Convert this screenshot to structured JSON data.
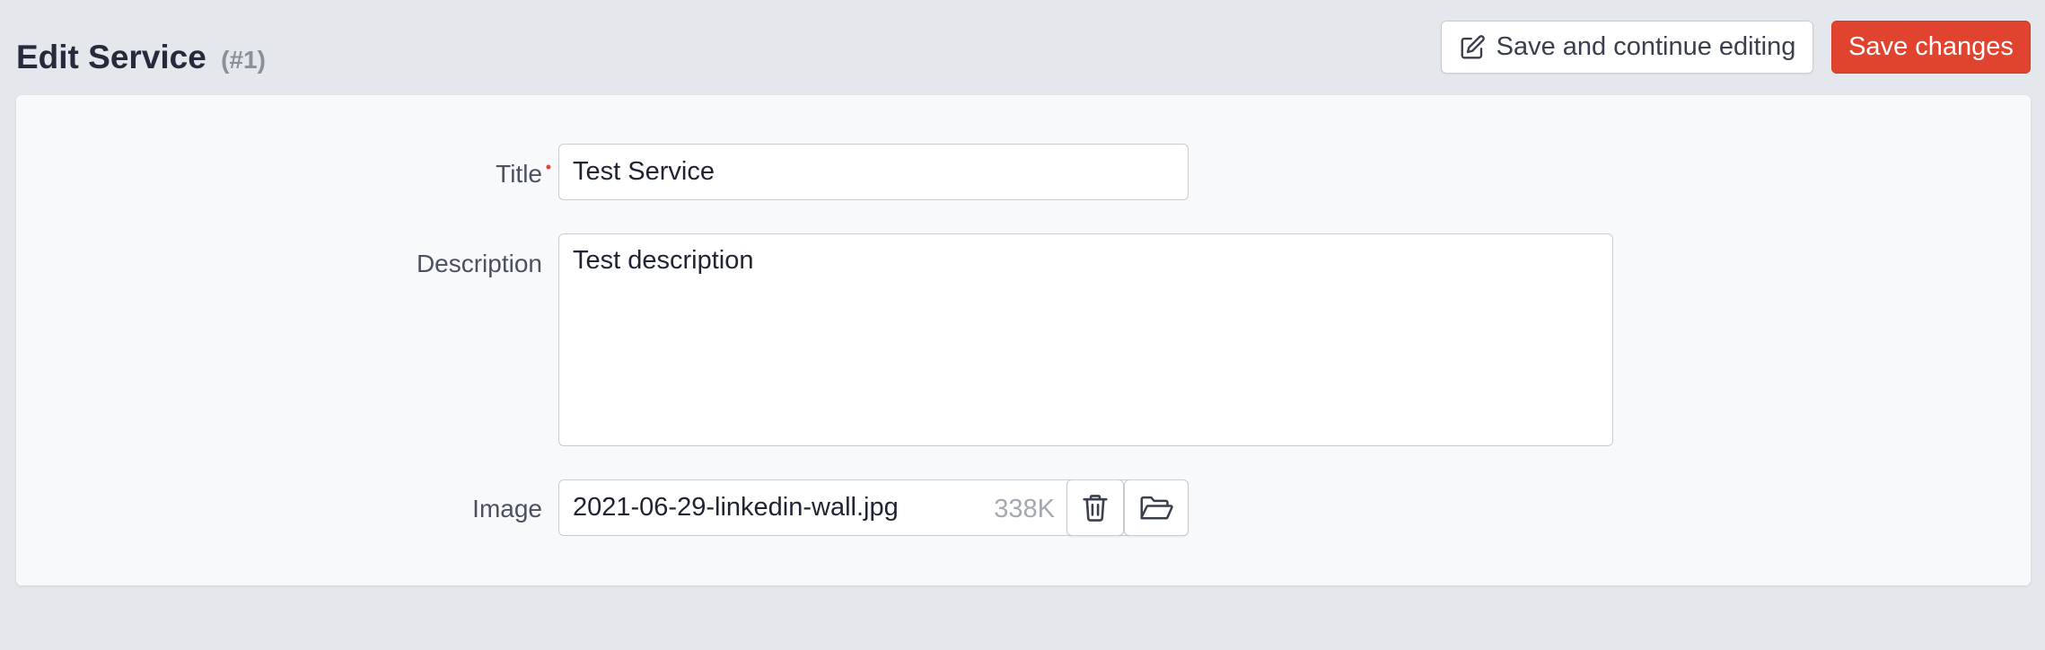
{
  "header": {
    "title": "Edit Service",
    "id_suffix": "(#1)",
    "save_continue_label": "Save and continue editing",
    "save_label": "Save changes",
    "save_icon": "edit-icon"
  },
  "form": {
    "title": {
      "label": "Title",
      "required_mark": "•",
      "value": "Test Service"
    },
    "description": {
      "label": "Description",
      "value": "Test description"
    },
    "image": {
      "label": "Image",
      "filename": "2021-06-29-linkedin-wall.jpg",
      "size": "338K",
      "delete_icon": "trash-icon",
      "browse_icon": "folder-open-icon"
    }
  },
  "colors": {
    "background": "#e4e7ec",
    "card": "#f8f9fb",
    "primary": "#e0442f",
    "border": "#c8ccd3"
  }
}
